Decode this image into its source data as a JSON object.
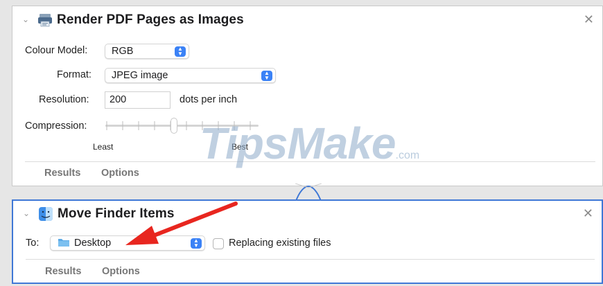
{
  "action1": {
    "title": "Render PDF Pages as Images",
    "icon": "pdf-render-icon",
    "colour_model": {
      "label": "Colour Model:",
      "value": "RGB"
    },
    "format": {
      "label": "Format:",
      "value": "JPEG image"
    },
    "resolution": {
      "label": "Resolution:",
      "value": "200",
      "unit": "dots per inch"
    },
    "compression": {
      "label": "Compression:",
      "min_label": "Least",
      "max_label": "Best",
      "level": 0.45
    },
    "tabs": [
      "Results",
      "Options"
    ]
  },
  "watermark": {
    "text": "TipsMake",
    "suffix": ".com"
  },
  "action2": {
    "title": "Move Finder Items",
    "icon": "finder-icon",
    "to": {
      "label": "To:",
      "value": "Desktop"
    },
    "replace": {
      "label": "Replacing existing files",
      "checked": false
    },
    "tabs": [
      "Results",
      "Options"
    ]
  },
  "annotation": {
    "arrow_color": "#e8261f"
  },
  "colors": {
    "accent": "#3b82f6",
    "selected_border": "#3f78d6",
    "folder": "#5aa9e6"
  }
}
